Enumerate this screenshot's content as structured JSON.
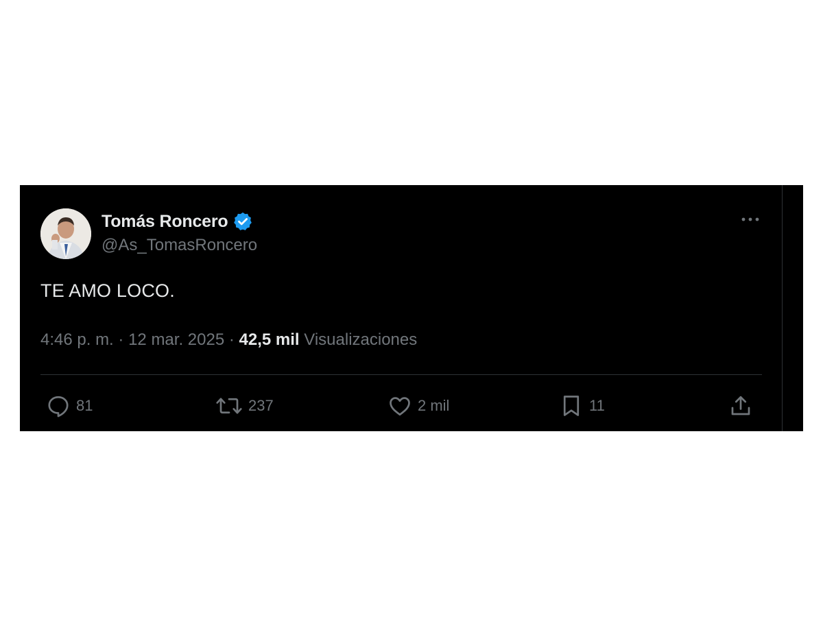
{
  "tweet": {
    "author": {
      "display_name": "Tomás Roncero",
      "handle": "@As_TomasRoncero",
      "verified_icon": "verified-badge-icon",
      "verified_color": "#1d9bf0"
    },
    "more_icon": "more-options-icon",
    "text": "TE AMO LOCO.",
    "meta": {
      "time": "4:46 p. m.",
      "separator": "·",
      "date": "12 mar. 2025",
      "views_count": "42,5 mil",
      "views_label": "Visualizaciones"
    },
    "actions": {
      "reply": {
        "icon": "reply-icon",
        "count": "81"
      },
      "retweet": {
        "icon": "retweet-icon",
        "count": "237"
      },
      "like": {
        "icon": "heart-icon",
        "count": "2 mil"
      },
      "bookmark": {
        "icon": "bookmark-icon",
        "count": "11"
      },
      "share": {
        "icon": "share-icon"
      }
    }
  },
  "colors": {
    "background": "#000000",
    "primary_text": "#e7e9ea",
    "secondary_text": "#71767b",
    "divider": "#2f3336",
    "accent": "#1d9bf0"
  }
}
